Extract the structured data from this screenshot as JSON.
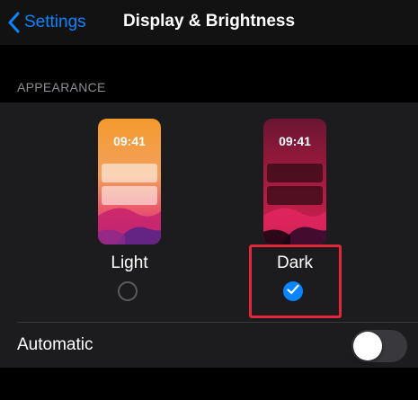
{
  "nav": {
    "back_label": "Settings",
    "title": "Display & Brightness",
    "back_icon": "chevron-left-icon"
  },
  "appearance": {
    "header": "APPEARANCE",
    "options": [
      {
        "label": "Light",
        "time": "09:41",
        "selected": false
      },
      {
        "label": "Dark",
        "time": "09:41",
        "selected": true
      }
    ],
    "automatic": {
      "label": "Automatic",
      "enabled": false
    }
  },
  "colors": {
    "accent": "#0a84ff",
    "highlight_box": "#e0283a",
    "background": "#000000",
    "group_background": "#1c1c1e"
  }
}
